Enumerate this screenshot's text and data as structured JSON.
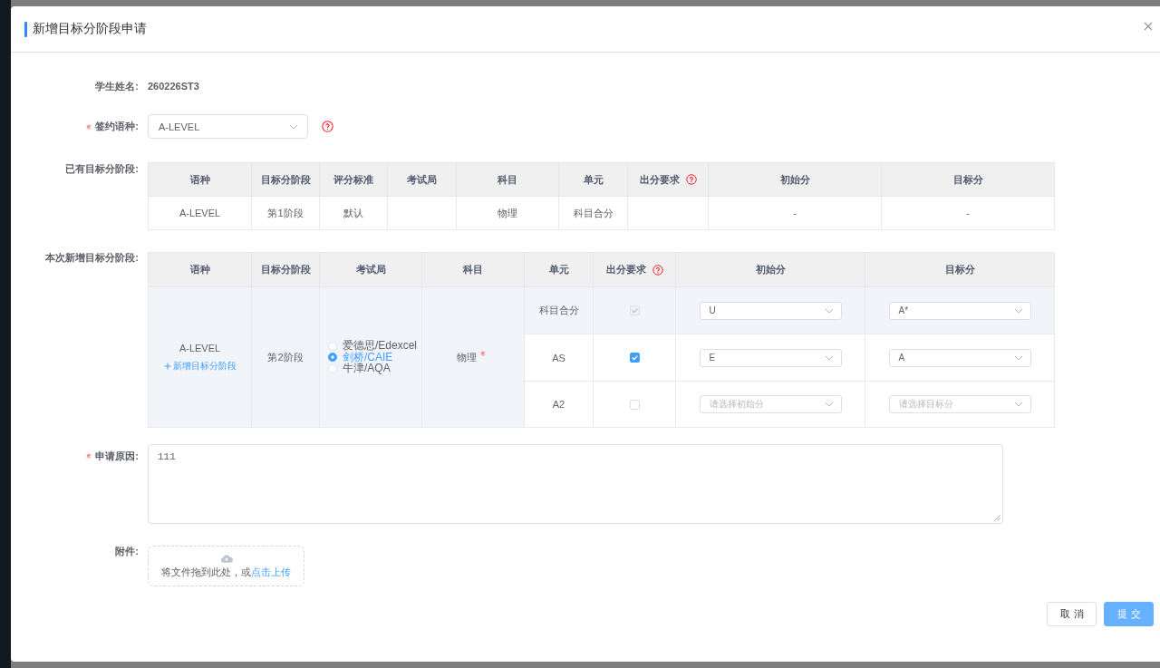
{
  "dialog": {
    "title": "新增目标分阶段申请"
  },
  "form": {
    "student_name": {
      "label": "学生姓名:",
      "required": false,
      "value": "260226ST3"
    },
    "contract_language": {
      "label": "签约语种:",
      "required": true,
      "value": "A-LEVEL",
      "help": true
    },
    "existing_stages": {
      "label": "已有目标分阶段:",
      "required": false,
      "columns": [
        {
          "label": "语种",
          "help": false
        },
        {
          "label": "目标分阶段",
          "help": false
        },
        {
          "label": "评分标准",
          "help": false
        },
        {
          "label": "考试局",
          "help": false
        },
        {
          "label": "科目",
          "help": false
        },
        {
          "label": "单元",
          "help": false
        },
        {
          "label": "出分要求",
          "help": true
        },
        {
          "label": "初始分",
          "help": false
        },
        {
          "label": "目标分",
          "help": false
        }
      ],
      "rows": [
        {
          "language": "A-LEVEL",
          "stage": "第1阶段",
          "grading_standard": "默认",
          "subject": "物理",
          "unit": "科目合分",
          "initial_score": "-",
          "target_score": "-"
        }
      ]
    },
    "new_stages": {
      "label": "本次新增目标分阶段:",
      "required": false,
      "columns": [
        {
          "label": "语种",
          "help": false
        },
        {
          "label": "目标分阶段",
          "help": false
        },
        {
          "label": "考试局",
          "help": false
        },
        {
          "label": "科目",
          "help": false
        },
        {
          "label": "单元",
          "help": false
        },
        {
          "label": "出分要求",
          "help": true
        },
        {
          "label": "初始分",
          "help": false
        },
        {
          "label": "目标分",
          "help": false
        }
      ],
      "language": "A-LEVEL",
      "add_link": "新增目标分阶段",
      "stage": "第2阶段",
      "exam_boards": [
        {
          "label": "爱德思/Edexcel",
          "selected": false
        },
        {
          "label": "剑桥/CAIE",
          "selected": true
        },
        {
          "label": "牛津/AQA",
          "selected": false
        }
      ],
      "subject": "物理",
      "subject_required": true,
      "units": [
        {
          "name": "科目合分",
          "highlighted": true,
          "checked": true,
          "disabled": true,
          "initial": {
            "value": "U"
          },
          "target": {
            "value": "A*"
          }
        },
        {
          "name": "AS",
          "highlighted": false,
          "checked": true,
          "disabled": false,
          "initial": {
            "value": "E"
          },
          "target": {
            "value": "A"
          }
        },
        {
          "name": "A2",
          "highlighted": false,
          "checked": false,
          "disabled": false,
          "initial": {
            "placeholder": "请选择初始分"
          },
          "target": {
            "placeholder": "请选择目标分"
          }
        }
      ]
    },
    "reason": {
      "label": "申请原因:",
      "required": true,
      "value": "111"
    },
    "attachment": {
      "label": "附件:",
      "required": false,
      "hint": "将文件拖到此处，或",
      "link": "点击上传"
    }
  },
  "buttons": [
    {
      "label": "取消",
      "kind": "default"
    },
    {
      "label": "提交",
      "kind": "primary"
    }
  ]
}
